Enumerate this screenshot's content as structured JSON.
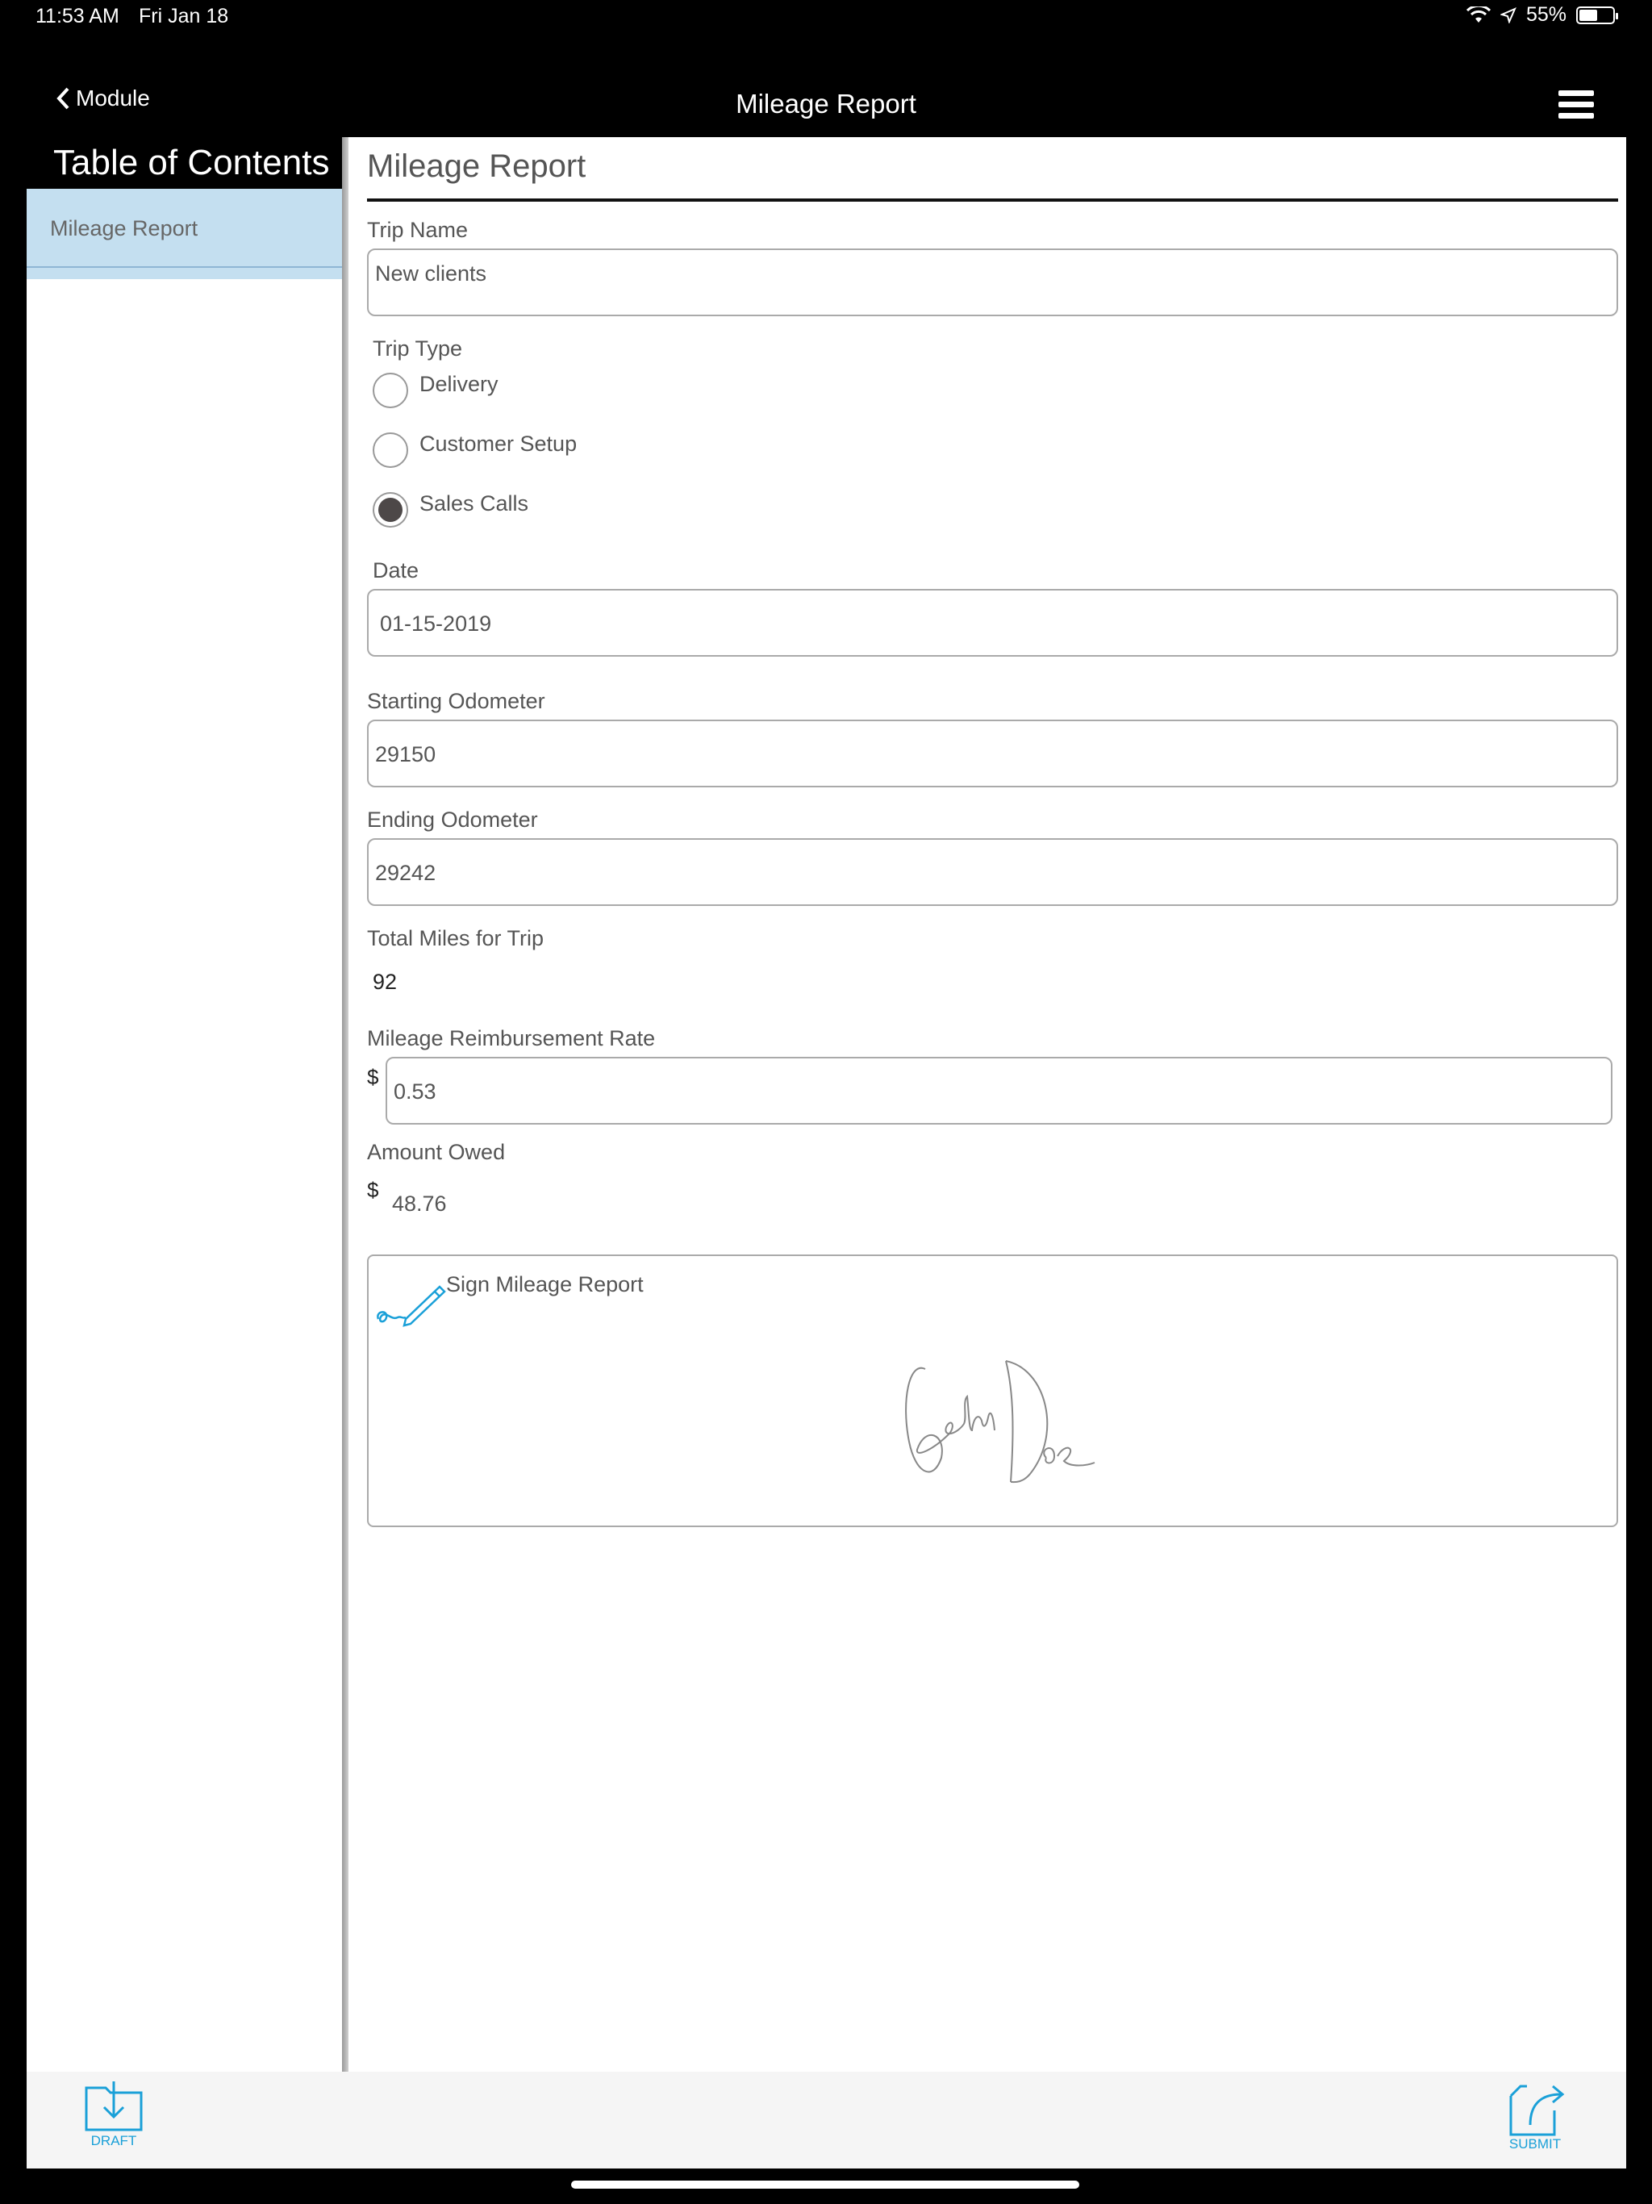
{
  "status": {
    "time": "11:53 AM",
    "date": "Fri Jan 18",
    "battery": "55%",
    "battery_level": 0.55
  },
  "nav": {
    "back_label": "Module",
    "title": "Mileage Report"
  },
  "sidebar": {
    "header": "Table of Contents",
    "items": [
      {
        "label": "Mileage Report",
        "selected": true
      }
    ]
  },
  "form": {
    "section_title": "Mileage Report",
    "trip_name": {
      "label": "Trip Name",
      "value": "New clients"
    },
    "trip_type": {
      "label": "Trip Type",
      "options": [
        {
          "label": "Delivery",
          "selected": false
        },
        {
          "label": "Customer Setup",
          "selected": false
        },
        {
          "label": "Sales Calls",
          "selected": true
        }
      ]
    },
    "date": {
      "label": "Date",
      "value": "01-15-2019"
    },
    "starting_odometer": {
      "label": "Starting Odometer",
      "value": "29150"
    },
    "ending_odometer": {
      "label": "Ending Odometer",
      "value": "29242"
    },
    "total_miles": {
      "label": "Total Miles for Trip",
      "value": "92"
    },
    "reimbursement_rate": {
      "label": "Mileage Reimbursement Rate",
      "currency": "$",
      "value": "0.53"
    },
    "amount_owed": {
      "label": "Amount Owed",
      "currency": "$",
      "value": "48.76"
    },
    "signature": {
      "label": "Sign Mileage Report",
      "signed_name": "John Doe"
    }
  },
  "toolbar": {
    "draft_label": "DRAFT",
    "submit_label": "SUBMIT"
  },
  "colors": {
    "accent": "#1aa0d8",
    "sidebar_selected": "#c4dff0",
    "radio_fill": "#4d4848"
  }
}
